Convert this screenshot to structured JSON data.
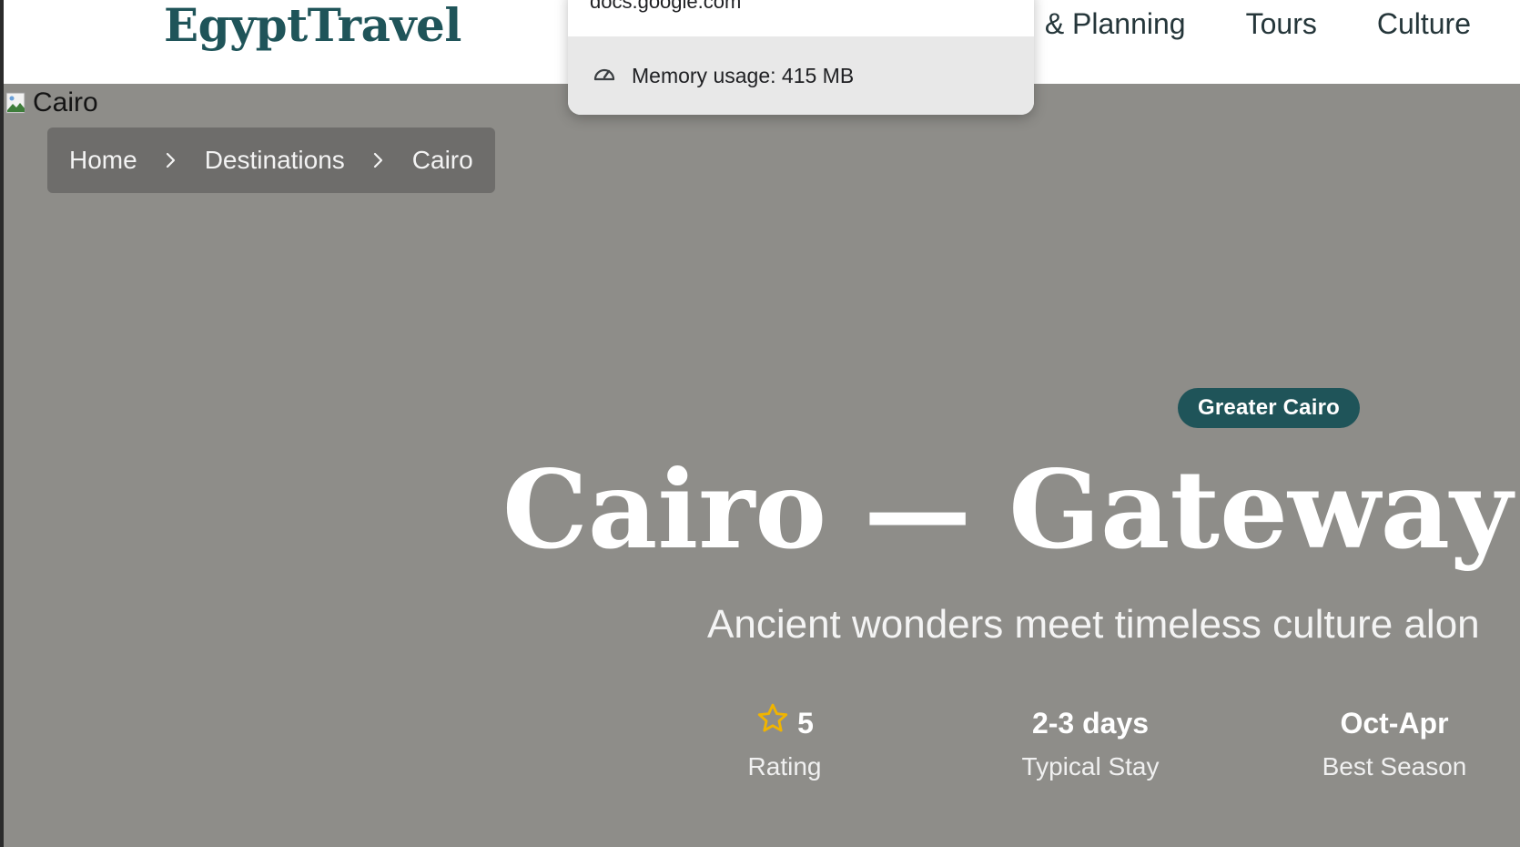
{
  "header": {
    "logo": "EgyptTravel",
    "nav": [
      "& Planning",
      "Tours",
      "Culture"
    ]
  },
  "popup": {
    "domain": "docs.google.com",
    "memory_label": "Memory usage: 415 MB"
  },
  "hero": {
    "broken_image_alt": "Cairo",
    "breadcrumb": [
      "Home",
      "Destinations",
      "Cairo"
    ],
    "badge": "Greater Cairo",
    "title": "Cairo — Gateway t",
    "subtitle": "Ancient wonders meet timeless culture alon",
    "stats": [
      {
        "value": "5",
        "label": "Rating",
        "icon": "star-icon"
      },
      {
        "value": "2-3 days",
        "label": "Typical Stay"
      },
      {
        "value": "Oct-Apr",
        "label": "Best Season"
      }
    ]
  },
  "colors": {
    "brand": "#1f5459",
    "hero_bg": "#8e8d89",
    "star": "#f0b400"
  }
}
